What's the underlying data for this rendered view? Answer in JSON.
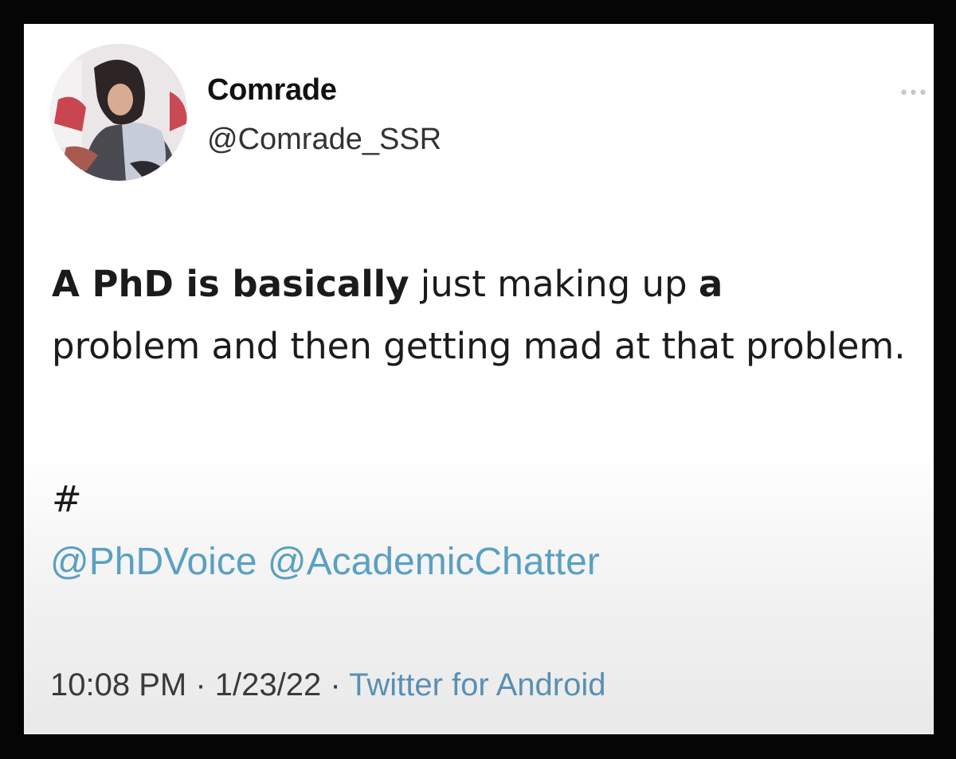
{
  "tweet": {
    "author": {
      "name": "Comrade",
      "handle": "@Comrade_SSR"
    },
    "text_bold_1": "A PhD is basically",
    "text_normal_1": " just making up ",
    "text_bold_2": "a",
    "text_normal_2": "problem and then getting mad at that problem.",
    "hashtag": "#",
    "mentions": [
      "@PhDVoice",
      "@AcademicChatter"
    ],
    "time": "10:08 PM",
    "date": "1/23/22",
    "separator": "·",
    "source": "Twitter for Android",
    "more_icon": "more-dots-icon"
  },
  "colors": {
    "mention": "#5aa0c2",
    "source": "#5a8fb3",
    "frame": "#050505"
  }
}
